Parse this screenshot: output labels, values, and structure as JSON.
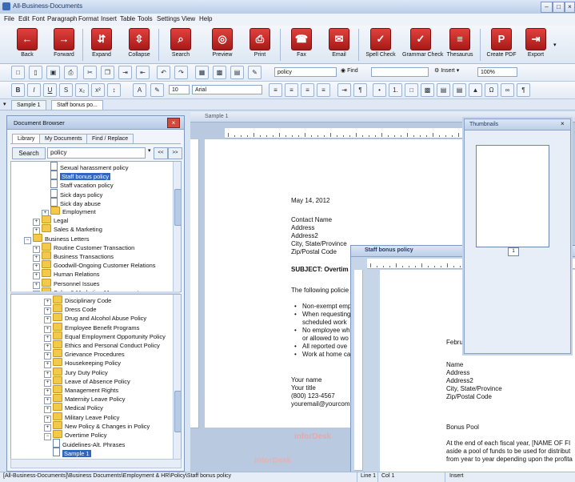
{
  "app": {
    "title": "All-Business-Documents"
  },
  "menu": [
    "File",
    "Edit",
    "Font",
    "Paragraph",
    "Format",
    "Insert",
    "Table",
    "Tools",
    "Settings",
    "View",
    "Help"
  ],
  "big_toolbar": [
    {
      "label": "Back",
      "icon": "back-arrow-icon",
      "glyph": "←"
    },
    {
      "label": "Forward",
      "icon": "forward-arrow-icon",
      "glyph": "→"
    },
    {
      "label": "Expand",
      "icon": "expand-icon",
      "glyph": "⇵"
    },
    {
      "label": "Collapse",
      "icon": "collapse-icon",
      "glyph": "⇳"
    },
    {
      "label": "Search",
      "icon": "magnifier-icon",
      "glyph": "⌕"
    },
    {
      "label": "Preview",
      "icon": "preview-icon",
      "glyph": "◎"
    },
    {
      "label": "Print",
      "icon": "printer-icon",
      "glyph": "⎙"
    },
    {
      "label": "Fax",
      "icon": "fax-icon",
      "glyph": "☎"
    },
    {
      "label": "Email",
      "icon": "envelope-icon",
      "glyph": "✉"
    },
    {
      "label": "Spell Check",
      "icon": "spell-check-icon",
      "glyph": "✓"
    },
    {
      "label": "Grammar Check",
      "icon": "grammar-check-icon",
      "glyph": "✓"
    },
    {
      "label": "Thesaurus",
      "icon": "thesaurus-icon",
      "glyph": "≡"
    },
    {
      "label": "Create PDF",
      "icon": "pdf-icon",
      "glyph": "P"
    },
    {
      "label": "Export",
      "icon": "export-icon",
      "glyph": "⇥"
    }
  ],
  "find_bar": {
    "search_value": "policy",
    "find_label": "Find",
    "insert_label": "Insert",
    "zoom": "100%"
  },
  "format_bar": {
    "font_size": "10",
    "font_name": "Arial"
  },
  "tabs": [
    "Sample 1",
    "Staff bonus po..."
  ],
  "browser": {
    "title": "Document Browser",
    "tabs": [
      "Library",
      "My Documents",
      "Find / Replace"
    ],
    "search_label": "Search",
    "search_value": "policy",
    "prev": "<<",
    "next": ">>",
    "upper_tree": [
      {
        "text": "Sexual harassment policy",
        "level": 3,
        "kind": "page"
      },
      {
        "text": "Staff bonus policy",
        "level": 3,
        "kind": "page",
        "selected": true
      },
      {
        "text": "Staff vacation policy",
        "level": 3,
        "kind": "page"
      },
      {
        "text": "Sick days policy",
        "level": 3,
        "kind": "page"
      },
      {
        "text": "Sick day abuse",
        "level": 3,
        "kind": "page"
      },
      {
        "text": "Employment",
        "level": 2,
        "kind": "folder"
      },
      {
        "text": "Legal",
        "level": 1,
        "kind": "folder"
      },
      {
        "text": "Sales & Marketing",
        "level": 1,
        "kind": "folder"
      },
      {
        "text": "Business Letters",
        "level": 0,
        "kind": "folder",
        "open": true
      },
      {
        "text": "Routine Customer Transaction",
        "level": 1,
        "kind": "folder"
      },
      {
        "text": "Business Transactions",
        "level": 1,
        "kind": "folder"
      },
      {
        "text": "Goodwill-Ongoing Customer Relations",
        "level": 1,
        "kind": "folder"
      },
      {
        "text": "Human Relations",
        "level": 1,
        "kind": "folder"
      },
      {
        "text": "Personnel Issues",
        "level": 1,
        "kind": "folder"
      },
      {
        "text": "Sales & Marketing Management",
        "level": 1,
        "kind": "folder"
      }
    ],
    "lower_tree": [
      {
        "text": "Disciplinary Code",
        "level": 1,
        "kind": "folder"
      },
      {
        "text": "Dress Code",
        "level": 1,
        "kind": "folder"
      },
      {
        "text": "Drug and Alcohol Abuse Policy",
        "level": 1,
        "kind": "folder"
      },
      {
        "text": "Employee Benefit Programs",
        "level": 1,
        "kind": "folder"
      },
      {
        "text": "Equal Employment Opportunity Policy",
        "level": 1,
        "kind": "folder"
      },
      {
        "text": "Ethics and Personal Conduct Policy",
        "level": 1,
        "kind": "folder"
      },
      {
        "text": "Grievance Procedures",
        "level": 1,
        "kind": "folder"
      },
      {
        "text": "Housekeeping Policy",
        "level": 1,
        "kind": "folder"
      },
      {
        "text": "Jury Duty Policy",
        "level": 1,
        "kind": "folder"
      },
      {
        "text": "Leave of Absence Policy",
        "level": 1,
        "kind": "folder"
      },
      {
        "text": "Management Rights",
        "level": 1,
        "kind": "folder"
      },
      {
        "text": "Maternity Leave Policy",
        "level": 1,
        "kind": "folder"
      },
      {
        "text": "Medical Policy",
        "level": 1,
        "kind": "folder"
      },
      {
        "text": "Military Leave Policy",
        "level": 1,
        "kind": "folder"
      },
      {
        "text": "New Policy & Changes in Policy",
        "level": 1,
        "kind": "folder"
      },
      {
        "text": "Overtime Policy",
        "level": 1,
        "kind": "folder",
        "open": true
      },
      {
        "text": "Guidelines-Alt. Phrases",
        "level": 2,
        "kind": "page"
      },
      {
        "text": "Sample 1",
        "level": 2,
        "kind": "page",
        "selected": true
      }
    ]
  },
  "doc1": {
    "window_title": "Sample 1",
    "lines": [
      "May 14, 2012",
      "Contact Name",
      "Address",
      "Address2",
      "City, State/Province",
      "Zip/Postal Code",
      "SUBJECT: Overtim",
      "The following policie",
      "Non-exempt empl",
      "When requesting",
      "scheduled work",
      "No employee wh",
      "or allowed to wo",
      "All reported ove",
      "Work at home ca",
      "Your name",
      "Your title",
      "(800) 123-4567",
      "youremail@yourcom"
    ]
  },
  "doc2": {
    "window_title": "Staff bonus policy",
    "lines": [
      "Febru",
      "Name",
      "Address",
      "Address2",
      "City, State/Province",
      "Zip/Postal Code",
      "Bonus Pool",
      "At the end of each fiscal year, [NAME OF FI",
      "aside a pool of funds to be used for distribut",
      "from year to year depending upon the profita"
    ]
  },
  "thumbnails": {
    "title": "Thumbnails",
    "page": "1"
  },
  "watermark": "inforDesk",
  "status": {
    "path": "[All-Business-Documents]\\Business Documents\\Employment & HR\\Policy\\Staff bonus policy",
    "line": "Line 1",
    "col": "Col 1",
    "mode": "Insert"
  }
}
